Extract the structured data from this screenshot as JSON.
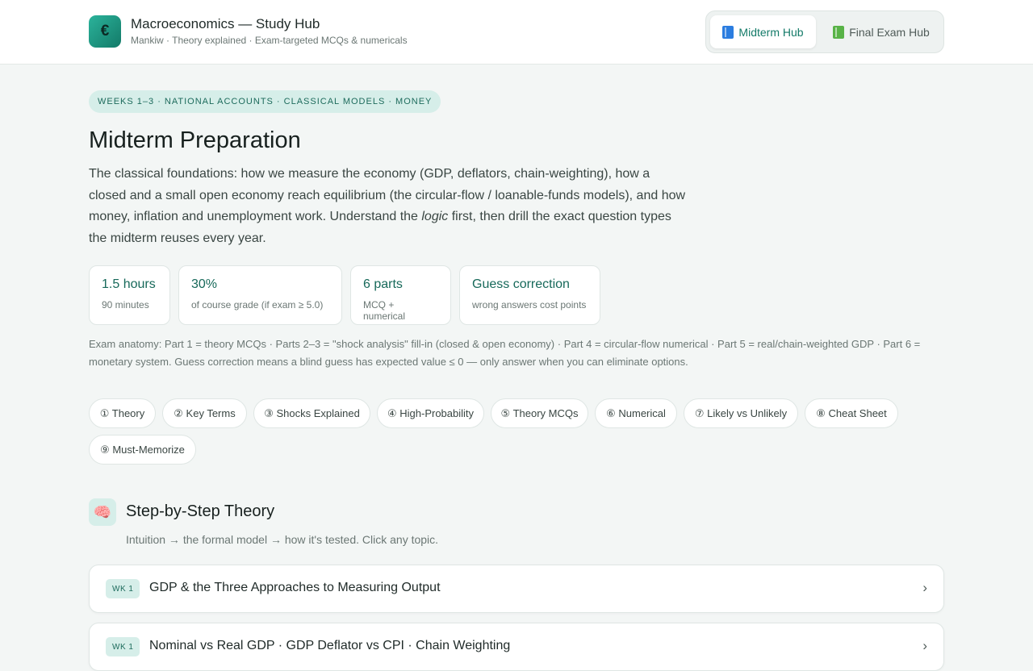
{
  "header": {
    "logo_glyph": "€",
    "title": "Macroeconomics — Study Hub",
    "subtitle": "Mankiw · Theory explained · Exam-targeted MCQs & numericals",
    "hubs": [
      {
        "label": "Midterm Hub",
        "icon": "blue-book-icon",
        "active": true
      },
      {
        "label": "Final Exam Hub",
        "icon": "green-book-icon",
        "active": false
      }
    ]
  },
  "hero": {
    "tag": "WEEKS 1–3 · NATIONAL ACCOUNTS · CLASSICAL MODELS · MONEY",
    "title": "Midterm Preparation",
    "intro_before": "The classical foundations: how we measure the economy (GDP, deflators, chain-weighting), how a closed and a small open economy reach equilibrium (the circular-flow / loanable-funds models), and how money, inflation and unemployment work. Understand the ",
    "intro_em": "logic",
    "intro_after": " first, then drill the exact question types the midterm reuses every year."
  },
  "stats": [
    {
      "value": "1.5 hours",
      "label": "90 minutes"
    },
    {
      "value": "30%",
      "label": "of course grade (if exam ≥ 5.0)"
    },
    {
      "value": "6 parts",
      "label": "MCQ + numerical"
    },
    {
      "value": "Guess correction",
      "label": "wrong answers cost points"
    }
  ],
  "anatomy": "Exam anatomy: Part 1 = theory MCQs · Parts 2–3 = \"shock analysis\" fill-in (closed & open economy) · Part 4 = circular-flow numerical · Part 5 = real/chain-weighted GDP · Part 6 = monetary system. Guess correction means a blind guess has expected value ≤ 0 — only answer when you can eliminate options.",
  "nav_chips": [
    "① Theory",
    "② Key Terms",
    "③ Shocks Explained",
    "④ High-Probability",
    "⑤ Theory MCQs",
    "⑥ Numerical",
    "⑦ Likely vs Unlikely",
    "⑧ Cheat Sheet",
    "⑨ Must-Memorize"
  ],
  "section": {
    "icon": "brain-icon",
    "icon_glyph": "🧠",
    "title": "Step-by-Step Theory",
    "subtitle": "Intuition → the formal model → how it's tested. Click any topic."
  },
  "topics": [
    {
      "week": "WK 1",
      "title": "GDP & the Three Approaches to Measuring Output"
    },
    {
      "week": "WK 1",
      "title": "Nominal vs Real GDP · GDP Deflator vs CPI · Chain Weighting"
    }
  ],
  "colors": {
    "accent": "#137a68",
    "accent_soft": "#d6eee9",
    "background": "#f3f6f5"
  }
}
